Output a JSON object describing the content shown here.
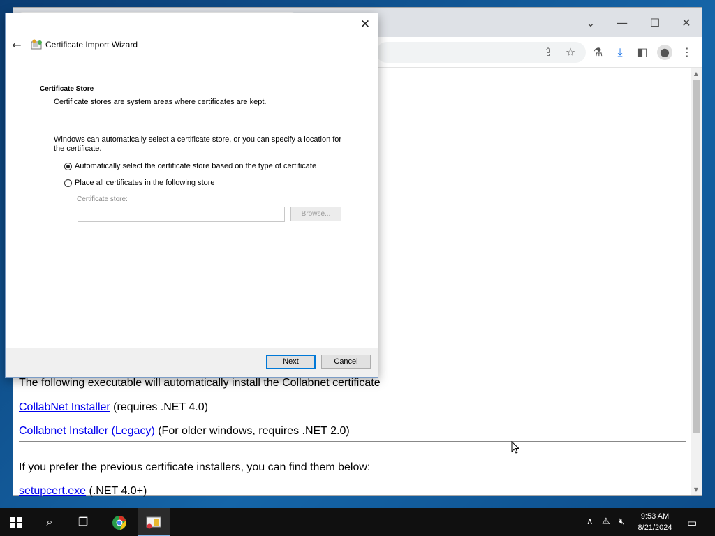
{
  "dialog": {
    "title": "Certificate Import Wizard",
    "close_icon": "close-icon",
    "back_icon": "back-arrow-icon",
    "heading": "Certificate Store",
    "subheading": "Certificate stores are system areas where certificates are kept.",
    "description": "Windows can automatically select a certificate store, or you can specify a location for the certificate.",
    "options": [
      {
        "label": "Automatically select the certificate store based on the type of certificate",
        "checked": true
      },
      {
        "label": "Place all certificates in the following store",
        "checked": false
      }
    ],
    "store_label": "Certificate store:",
    "store_value": "",
    "browse_label": "Browse...",
    "next_label": "Next",
    "cancel_label": "Cancel"
  },
  "page": {
    "partial_line": "The following executable will automatically install the Collabnet certificate",
    "links": [
      {
        "text": "CollabNet Installer",
        "note": " (requires .NET 4.0)"
      },
      {
        "text": "Collabnet Installer (Legacy)",
        "note": " (For older windows, requires .NET 2.0)"
      }
    ],
    "prev_text": "If you prefer the previous certificate installers, you can find them below:",
    "setup_link": "setupcert.exe",
    "setup_note": " (.NET 4.0+)"
  },
  "taskbar": {
    "time": "9:53 AM",
    "date": "8/21/2024"
  },
  "colors": {
    "link": "#0000ee",
    "accent": "#0078d7"
  }
}
